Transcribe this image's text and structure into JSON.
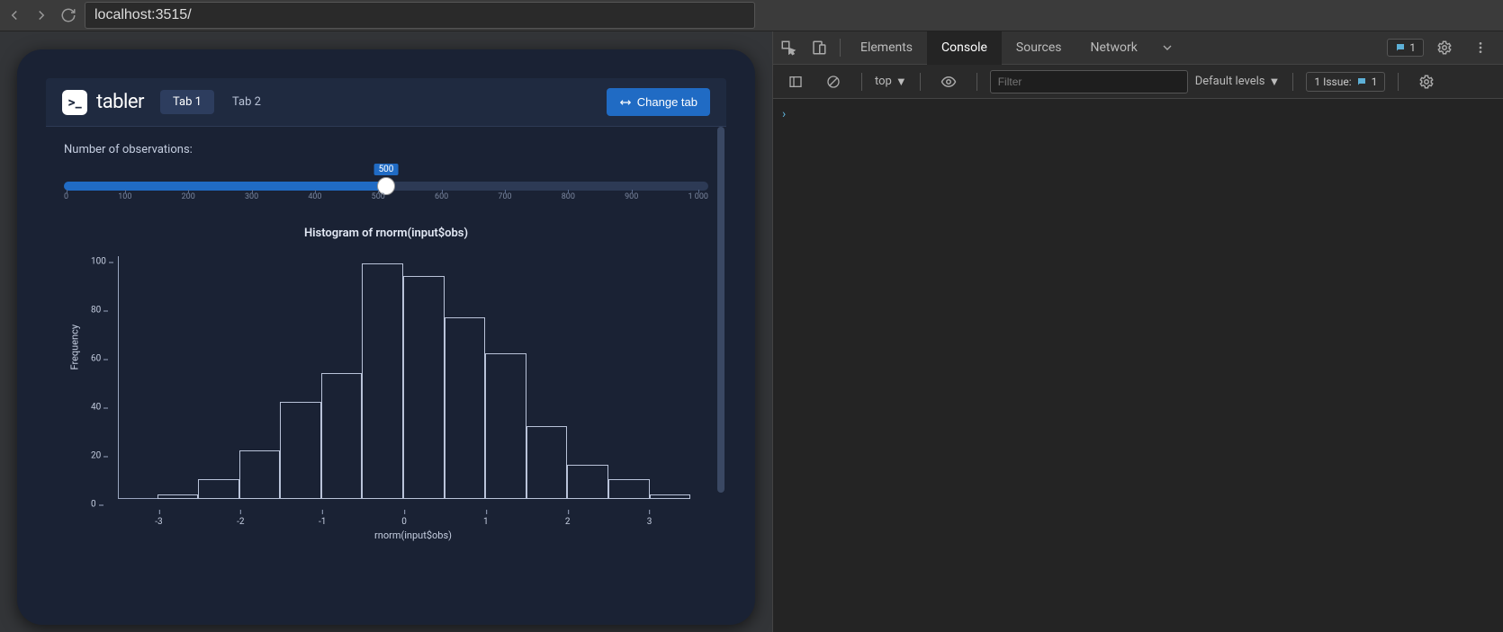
{
  "browser": {
    "url": "localhost:3515/"
  },
  "devtools": {
    "tabs": [
      "Elements",
      "Console",
      "Sources",
      "Network"
    ],
    "active_tab": "Console",
    "messages_badge": "1",
    "context": "top",
    "filter_placeholder": "Filter",
    "levels": "Default levels",
    "issues_label": "1 Issue:",
    "issues_count": "1"
  },
  "app": {
    "brand": "tabler",
    "tabs": {
      "tab1": "Tab 1",
      "tab2": "Tab 2"
    },
    "change_button": "Change tab",
    "slider": {
      "label": "Number of observations:",
      "value": "500",
      "min": 0,
      "max": 1000,
      "ticks": [
        "0",
        "100",
        "200",
        "300",
        "400",
        "500",
        "600",
        "700",
        "800",
        "900",
        "1 000"
      ]
    }
  },
  "chart_data": {
    "type": "bar",
    "title": "Histogram of rnorm(input$obs)",
    "xlabel": "rnorm(input$obs)",
    "ylabel": "Frequency",
    "ylim": [
      0,
      100
    ],
    "yticks": [
      0,
      20,
      40,
      60,
      80,
      100
    ],
    "x_breaks": [
      -3.5,
      -3,
      -2.5,
      -2,
      -1.5,
      -1,
      -0.5,
      0,
      0.5,
      1,
      1.5,
      2,
      2.5,
      3,
      3.5
    ],
    "xticks": [
      -3,
      -2,
      -1,
      0,
      1,
      2,
      3
    ],
    "values": [
      0,
      2,
      8,
      20,
      40,
      52,
      97,
      92,
      75,
      60,
      30,
      14,
      8,
      2
    ]
  }
}
